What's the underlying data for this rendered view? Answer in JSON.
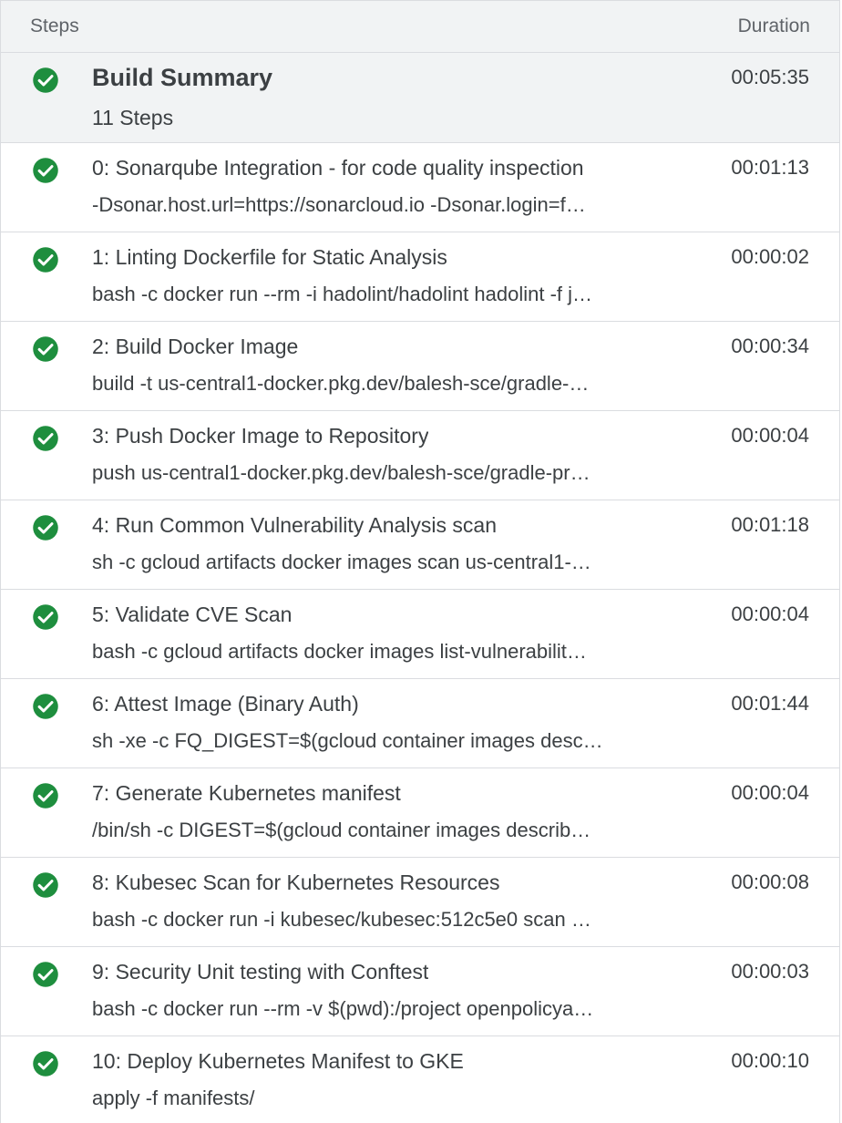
{
  "header": {
    "steps_label": "Steps",
    "duration_label": "Duration"
  },
  "colors": {
    "success": "#1e8e3e",
    "header_bg": "#f1f3f4",
    "divider": "#dadce0"
  },
  "summary": {
    "icon": "check-circle-icon",
    "title": "Build Summary",
    "subtitle": "11 Steps",
    "duration": "00:05:35"
  },
  "steps": [
    {
      "icon": "check-circle-icon",
      "title": "0: Sonarqube Integration - for code quality inspection",
      "command": "-Dsonar.host.url=https://sonarcloud.io -Dsonar.login=f…",
      "duration": "00:01:13"
    },
    {
      "icon": "check-circle-icon",
      "title": "1: Linting Dockerfile for Static Analysis",
      "command": "bash -c docker run --rm -i hadolint/hadolint hadolint -f j…",
      "duration": "00:00:02"
    },
    {
      "icon": "check-circle-icon",
      "title": "2: Build Docker Image",
      "command": "build -t us-central1-docker.pkg.dev/balesh-sce/gradle-…",
      "duration": "00:00:34"
    },
    {
      "icon": "check-circle-icon",
      "title": "3: Push Docker Image to Repository",
      "command": "push us-central1-docker.pkg.dev/balesh-sce/gradle-pr…",
      "duration": "00:00:04"
    },
    {
      "icon": "check-circle-icon",
      "title": "4: Run Common Vulnerability Analysis scan",
      "command": "sh -c gcloud artifacts docker images scan us-central1-…",
      "duration": "00:01:18"
    },
    {
      "icon": "check-circle-icon",
      "title": "5: Validate CVE Scan",
      "command": "bash -c gcloud artifacts docker images list-vulnerabilit…",
      "duration": "00:00:04"
    },
    {
      "icon": "check-circle-icon",
      "title": "6: Attest Image (Binary Auth)",
      "command": "sh -xe -c FQ_DIGEST=$(gcloud container images desc…",
      "duration": "00:01:44"
    },
    {
      "icon": "check-circle-icon",
      "title": "7: Generate Kubernetes manifest",
      "command": "/bin/sh -c DIGEST=$(gcloud container images describ…",
      "duration": "00:00:04"
    },
    {
      "icon": "check-circle-icon",
      "title": "8: Kubesec Scan for Kubernetes Resources",
      "command": "bash -c docker run -i kubesec/kubesec:512c5e0 scan …",
      "duration": "00:00:08"
    },
    {
      "icon": "check-circle-icon",
      "title": "9: Security Unit testing with Conftest",
      "command": "bash -c docker run --rm -v $(pwd):/project openpolicya…",
      "duration": "00:00:03"
    },
    {
      "icon": "check-circle-icon",
      "title": "10: Deploy Kubernetes Manifest to GKE",
      "command": "apply -f manifests/",
      "duration": "00:00:10"
    }
  ]
}
